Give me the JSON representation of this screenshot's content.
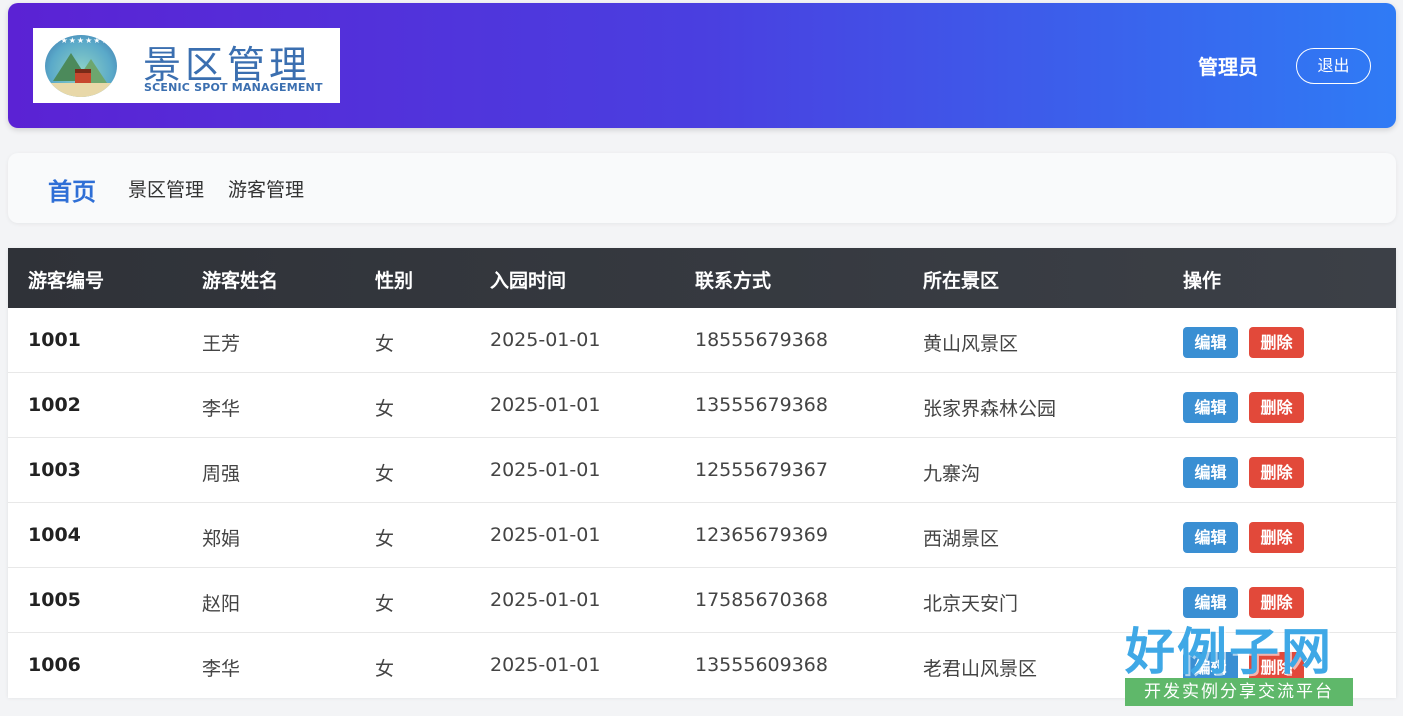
{
  "header": {
    "logo_title": "景区管理",
    "logo_subtitle": "SCENIC SPOT MANAGEMENT",
    "logo_stars": "★★★★★★★",
    "user_label": "管理员",
    "logout_label": "退出"
  },
  "nav": {
    "items": [
      {
        "label": "首页",
        "active": true
      },
      {
        "label": "景区管理",
        "active": false
      },
      {
        "label": "游客管理",
        "active": false
      }
    ]
  },
  "table": {
    "columns": [
      "游客编号",
      "游客姓名",
      "性别",
      "入园时间",
      "联系方式",
      "所在景区",
      "操作"
    ],
    "rows": [
      {
        "id": "1001",
        "name": "王芳",
        "gender": "女",
        "date": "2025-01-01",
        "phone": "18555679368",
        "spot": "黄山风景区"
      },
      {
        "id": "1002",
        "name": "李华",
        "gender": "女",
        "date": "2025-01-01",
        "phone": "13555679368",
        "spot": "张家界森林公园"
      },
      {
        "id": "1003",
        "name": "周强",
        "gender": "女",
        "date": "2025-01-01",
        "phone": "12555679367",
        "spot": "九寨沟"
      },
      {
        "id": "1004",
        "name": "郑娟",
        "gender": "女",
        "date": "2025-01-01",
        "phone": "12365679369",
        "spot": "西湖景区"
      },
      {
        "id": "1005",
        "name": "赵阳",
        "gender": "女",
        "date": "2025-01-01",
        "phone": "17585670368",
        "spot": "北京天安门"
      },
      {
        "id": "1006",
        "name": "李华",
        "gender": "女",
        "date": "2025-01-01",
        "phone": "13555609368",
        "spot": "老君山风景区"
      }
    ],
    "edit_label": "编辑",
    "delete_label": "删除"
  },
  "watermark": {
    "title": "好例子网",
    "subtitle": "开发实例分享交流平台"
  },
  "colors": {
    "header_gradient_start": "#5b22d4",
    "header_gradient_end": "#2f7bf5",
    "nav_active": "#2f6fd6",
    "table_header": "#2f3238",
    "edit_button": "#3a8fd3",
    "delete_button": "#e2493a"
  }
}
